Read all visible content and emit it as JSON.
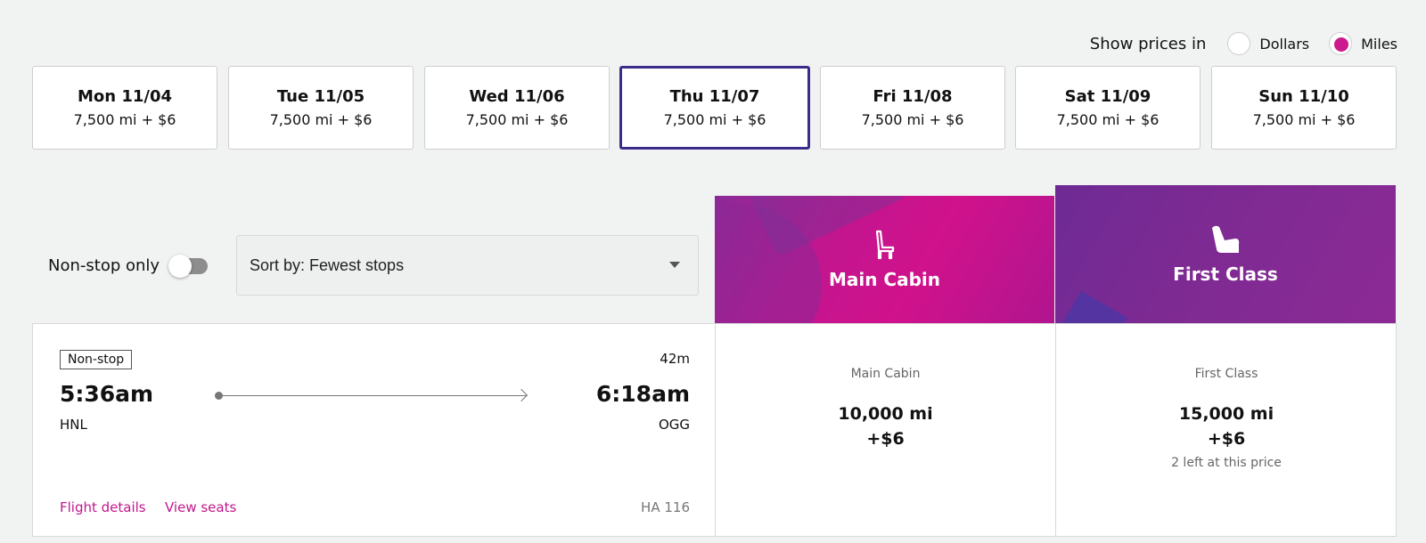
{
  "price_toggle": {
    "label": "Show prices in",
    "options": [
      {
        "label": "Dollars",
        "selected": false
      },
      {
        "label": "Miles",
        "selected": true
      }
    ]
  },
  "dates": [
    {
      "day": "Mon 11/04",
      "price": "7,500 mi + $6",
      "selected": false
    },
    {
      "day": "Tue 11/05",
      "price": "7,500 mi + $6",
      "selected": false
    },
    {
      "day": "Wed 11/06",
      "price": "7,500 mi + $6",
      "selected": false
    },
    {
      "day": "Thu 11/07",
      "price": "7,500 mi + $6",
      "selected": true
    },
    {
      "day": "Fri 11/08",
      "price": "7,500 mi + $6",
      "selected": false
    },
    {
      "day": "Sat 11/09",
      "price": "7,500 mi + $6",
      "selected": false
    },
    {
      "day": "Sun 11/10",
      "price": "7,500 mi + $6",
      "selected": false
    }
  ],
  "filters": {
    "nonstop_label": "Non-stop only",
    "nonstop_on": false,
    "sort_label": "Sort by: Fewest stops"
  },
  "cabins": [
    {
      "title": "Main Cabin",
      "icon": "seat-icon"
    },
    {
      "title": "First Class",
      "icon": "recliner-seat-icon"
    }
  ],
  "flight": {
    "badge": "Non-stop",
    "duration": "42m",
    "departure_time": "5:36am",
    "arrival_time": "6:18am",
    "origin": "HNL",
    "destination": "OGG",
    "details_link": "Flight details",
    "seats_link": "View seats",
    "flight_number": "HA 116"
  },
  "fares": [
    {
      "cabin": "Main Cabin",
      "miles": "10,000 mi",
      "fee": "+$6",
      "note": ""
    },
    {
      "cabin": "First Class",
      "miles": "15,000 mi",
      "fee": "+$6",
      "note": "2 left at this price"
    }
  ],
  "colors": {
    "accent": "#cc1b8c",
    "selected_border": "#3b2c8c",
    "main_cabin": "#c0168f",
    "first_class": "#7d2a93"
  }
}
